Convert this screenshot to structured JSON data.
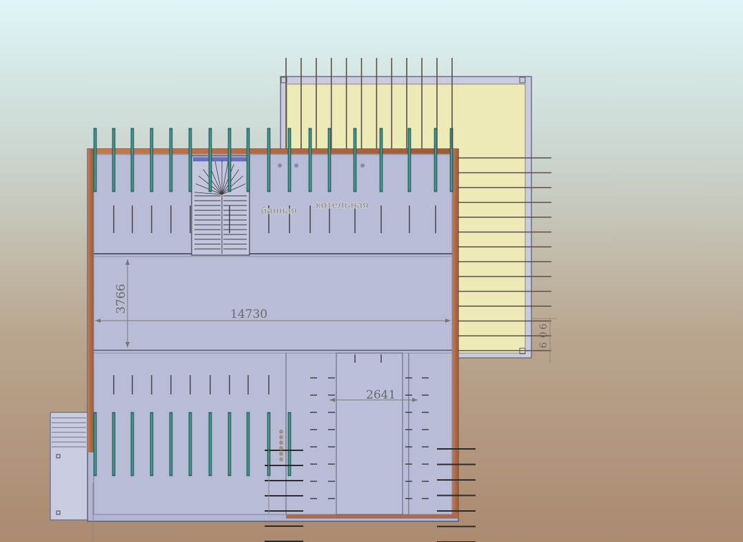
{
  "window": {
    "title": ""
  },
  "rooms": {
    "bath_label": "банная",
    "boiler_label": "котельная"
  },
  "dimensions": {
    "overall_width": "14730",
    "bay_depth": "3766",
    "corridor_width": "2641",
    "small_dim_a": "6",
    "small_dim_b": "0",
    "small_dim_c": "6"
  },
  "colors": {
    "background_top": "#def5f7",
    "background_bottom": "#ab8a70",
    "slab": "#b3b6d2",
    "terrace": "#ecebb8",
    "wall": "#b06a45",
    "joist": "#2f7f7a",
    "rebar": "#6a5a4a",
    "dimension_text": "#666666"
  }
}
